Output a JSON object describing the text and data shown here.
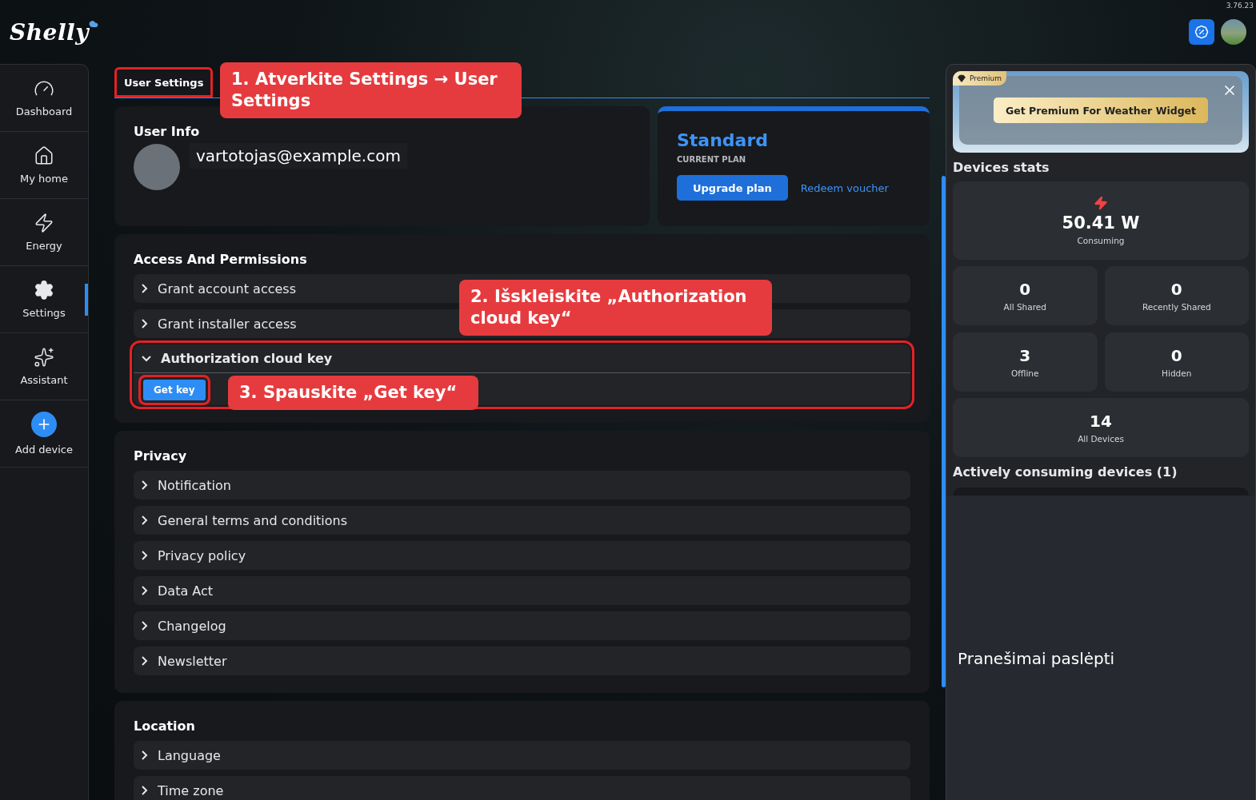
{
  "brand": {
    "logo": "Shelly"
  },
  "version": "3.76.23",
  "sidebar": {
    "items": [
      {
        "label": "Dashboard",
        "selected": false
      },
      {
        "label": "My home",
        "selected": false
      },
      {
        "label": "Energy",
        "selected": false
      },
      {
        "label": "Settings",
        "selected": true
      },
      {
        "label": "Assistant",
        "selected": false
      },
      {
        "label": "Add device",
        "selected": false
      }
    ]
  },
  "tabs": [
    {
      "label": "User Settings",
      "selected": true,
      "highlighted": true
    }
  ],
  "user_info": {
    "title": "User Info",
    "email": "vartotojas@example.com"
  },
  "plan": {
    "name": "Standard",
    "caption": "CURRENT PLAN",
    "upgrade": "Upgrade plan",
    "voucher": "Redeem voucher"
  },
  "sections": [
    {
      "title": "Access And Permissions",
      "items": [
        {
          "label": "Grant account access",
          "expanded": false,
          "highlighted": false
        },
        {
          "label": "Grant installer access",
          "expanded": false,
          "highlighted": false
        },
        {
          "label": "Authorization cloud key",
          "expanded": true,
          "highlighted": true,
          "action": {
            "label": "Get key",
            "highlighted": true
          }
        }
      ]
    },
    {
      "title": "Privacy",
      "items": [
        {
          "label": "Notification",
          "expanded": false,
          "highlighted": false
        },
        {
          "label": "General terms and conditions",
          "expanded": false,
          "highlighted": false
        },
        {
          "label": "Privacy policy",
          "expanded": false,
          "highlighted": false
        },
        {
          "label": "Data Act",
          "expanded": false,
          "highlighted": false
        },
        {
          "label": "Changelog",
          "expanded": false,
          "highlighted": false
        },
        {
          "label": "Newsletter",
          "expanded": false,
          "highlighted": false
        }
      ]
    },
    {
      "title": "Location",
      "items": [
        {
          "label": "Language",
          "expanded": false,
          "highlighted": false
        },
        {
          "label": "Time zone",
          "expanded": false,
          "highlighted": false
        }
      ]
    }
  ],
  "right_panel": {
    "premium_badge": "Premium",
    "premium_button": "Get Premium For Weather Widget",
    "stats_title": "Devices stats",
    "power": {
      "value": "50.41 W",
      "caption": "Consuming"
    },
    "stats": [
      {
        "value": "0",
        "label": "All Shared"
      },
      {
        "value": "0",
        "label": "Recently Shared"
      },
      {
        "value": "3",
        "label": "Offline"
      },
      {
        "value": "0",
        "label": "Hidden"
      }
    ],
    "total": {
      "value": "14",
      "label": "All Devices"
    },
    "consuming_title": "Actively consuming devices (1)",
    "notice": "Pranešimai paslėpti"
  },
  "annotations": [
    {
      "text": "1. Atverkite Settings → User Settings"
    },
    {
      "text": "2. Išskleiskite „Authorization cloud key“"
    },
    {
      "text": "3. Spauskite „Get key“"
    }
  ]
}
